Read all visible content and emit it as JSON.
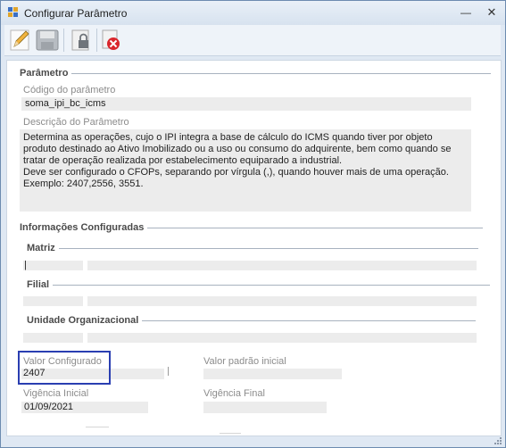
{
  "window": {
    "title": "Configurar Parâmetro",
    "minimize_glyph": "—",
    "close_glyph": "✕"
  },
  "toolbar": {
    "buttons": [
      {
        "icon": "edit-pencil-icon"
      },
      {
        "icon": "save-disk-icon"
      },
      {
        "icon": "lock-document-icon"
      },
      {
        "icon": "cancel-icon"
      }
    ]
  },
  "parametro": {
    "group_title": "Parâmetro",
    "codigo_label": "Código do parâmetro",
    "codigo_value": "soma_ipi_bc_icms",
    "descricao_label": "Descrição do Parâmetro",
    "descricao_value": "Determina as operações, cujo o IPI integra a base de cálculo do ICMS quando tiver por objeto produto destinado ao Ativo Imobilizado ou a uso ou consumo do adquirente, bem como quando se tratar de operação realizada por estabelecimento equiparado a industrial.\nDeve ser configurado o CFOPs, separando por vírgula (,), quando houver mais de uma operação.\nExemplo: 2407,2556, 3551."
  },
  "informacoes": {
    "group_title": "Informações Configuradas",
    "matriz_title": "Matriz",
    "filial_title": "Filial",
    "unidade_title": "Unidade Organizacional",
    "matriz_cursor": "|"
  },
  "valores": {
    "valor_configurado_label": "Valor Configurado",
    "valor_configurado_value": "2407",
    "valor_padrao_label": "Valor padrão inicial",
    "valor_padrao_value": "",
    "vigencia_inicial_label": "Vigência Inicial",
    "vigencia_inicial_value": "01/09/2021",
    "vigencia_final_label": "Vigência Final",
    "vigencia_final_value": ""
  },
  "colors": {
    "highlight": "#2a3eb1",
    "field_bg": "#ececec",
    "titlebar": "#dfe8f3"
  }
}
